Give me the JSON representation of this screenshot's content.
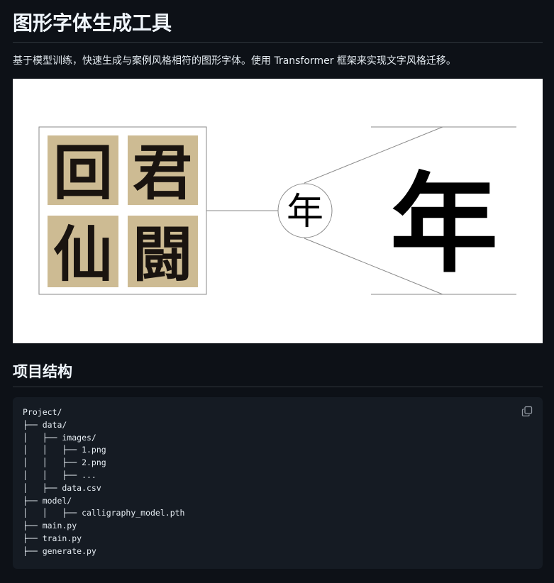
{
  "header": {
    "title": "图形字体生成工具"
  },
  "intro": {
    "text": "基于模型训练，快速生成与案例风格相符的图形字体。使用 Transformer 框架来实现文字风格迁移。"
  },
  "figure": {
    "samples": [
      "回",
      "君",
      "仙",
      "闘"
    ],
    "input_char": "年",
    "output_char": "年"
  },
  "section": {
    "title": "项目结构"
  },
  "code": {
    "lines": [
      "Project/",
      "├── data/",
      "│   ├── images/",
      "│   │   ├── 1.png",
      "│   │   ├── 2.png",
      "│   │   ├── ...",
      "│   ├── data.csv",
      "├── model/",
      "│   │   ├── calligraphy_model.pth",
      "├── main.py",
      "├── train.py",
      "├── generate.py"
    ],
    "copy_icon": "copy-icon"
  }
}
